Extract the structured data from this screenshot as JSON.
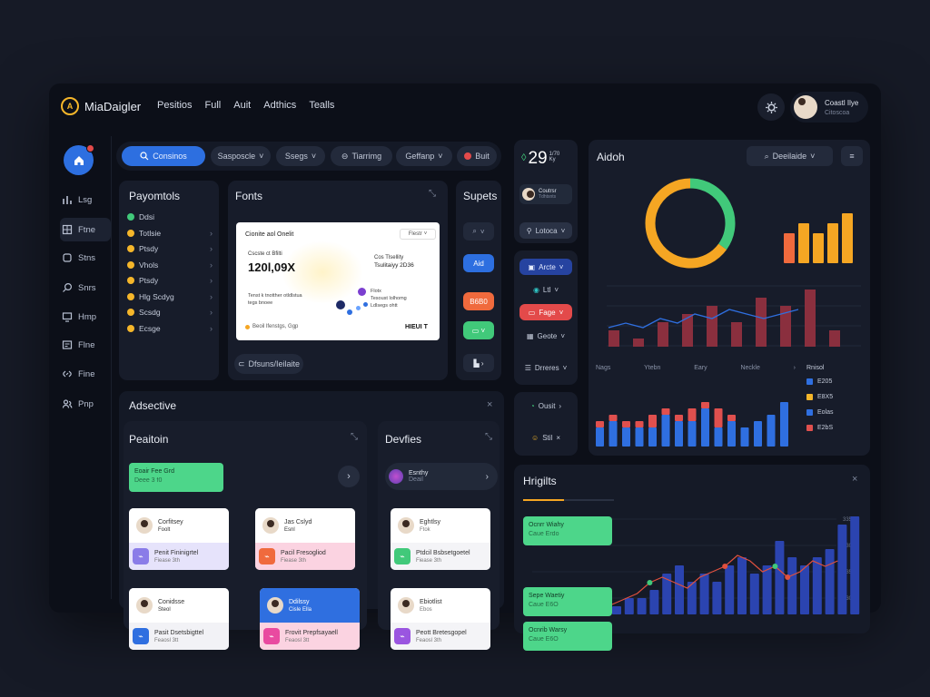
{
  "app": {
    "name": "MiaDaigler",
    "nav": [
      "Pesitios",
      "Full",
      "Auit",
      "Adthics",
      "Tealls"
    ]
  },
  "user": {
    "name": "Coastl Ilye",
    "role": "Citoscoa"
  },
  "sidebar": {
    "items": [
      "Lsg",
      "Ftne",
      "Stns",
      "Snrs",
      "Hmp",
      "Flne",
      "Fine",
      "Pnp"
    ]
  },
  "filters": {
    "search": "Consinos",
    "items": [
      "Sasposcle",
      "Ssegs",
      "Tiarrimg",
      "Geffanp",
      "Buit"
    ]
  },
  "payments": {
    "title": "Payomtols",
    "items": [
      {
        "label": "Ddsi",
        "color": "#41c97a"
      },
      {
        "label": "Totlsie",
        "color": "#f5b62a"
      },
      {
        "label": "Ptsdy",
        "color": "#f5b62a"
      },
      {
        "label": "Vhols",
        "color": "#f5b62a"
      },
      {
        "label": "Ptsdy",
        "color": "#f5b62a"
      },
      {
        "label": "Hlg Scdyg",
        "color": "#f5b62a"
      },
      {
        "label": "Scsdg",
        "color": "#f5b62a"
      },
      {
        "label": "Ecsge",
        "color": "#f5b62a"
      }
    ]
  },
  "fonts_card": {
    "title": "Fonts",
    "paper": {
      "heading": "Cionite aol Onelit",
      "badge": "Flestr",
      "amount_label": "Cscste ct Bfilti",
      "amount": "120l,09X",
      "right_label": "Cos Tlsellity",
      "right_value": "Tsulitaiyy 2D36",
      "note": "Tenst k tnotther otldlstua",
      "note2": "tegs bnoee",
      "legend1": "Flotx",
      "legend2": "Tesoust lolhomg",
      "legend3": "Ldlsegs ohtt",
      "footer": "Beoil lfenstgs, Ggp",
      "footer_right": "HIEUI T"
    },
    "button": "Dfsuns/Ieilaite"
  },
  "supets": {
    "title": "Supets",
    "items": [
      "Aid",
      "B6B0"
    ]
  },
  "stat": {
    "value": "29",
    "sup": "1/70",
    "sub": "Ky"
  },
  "quick": {
    "profile_name": "Coutrsr",
    "profile_sub": "Tdhtsnts",
    "action1": "Lotoca",
    "action2": "Arcte",
    "action3": "Ltl",
    "action4": "Fage",
    "action5": "Geote",
    "action6": "Drreres",
    "action7": "Ousit",
    "action8": "Stil"
  },
  "analytics": {
    "title": "Aidoh",
    "dropdown": "Deeilaide",
    "axis": [
      "Nags",
      "Ytebn",
      "Eary",
      "Neckle"
    ],
    "legend_title": "Rnisol",
    "legend": [
      {
        "label": "E205",
        "color": "#2f6fe0"
      },
      {
        "label": "E8X5",
        "color": "#f5b62a"
      },
      {
        "label": "Eolas",
        "color": "#2f6fe0"
      },
      {
        "label": "E2bS",
        "color": "#e0504e"
      }
    ],
    "donut": [
      {
        "value": 35,
        "color": "#41c97a"
      },
      {
        "value": 65,
        "color": "#f5a623"
      }
    ],
    "bars_top": [
      3,
      4,
      3,
      4,
      5
    ],
    "bars_mid": [
      2,
      1,
      3,
      4,
      5,
      3,
      6,
      5,
      7,
      2
    ],
    "line_mid": [
      3,
      4,
      3,
      5,
      4,
      6,
      5,
      7,
      6,
      5,
      6,
      7
    ],
    "stack": [
      [
        3,
        1
      ],
      [
        4,
        1
      ],
      [
        3,
        1
      ],
      [
        3,
        1
      ],
      [
        3,
        2
      ],
      [
        5,
        1
      ],
      [
        4,
        1
      ],
      [
        4,
        2
      ],
      [
        6,
        1
      ],
      [
        3,
        3
      ],
      [
        4,
        1
      ],
      [
        3,
        0
      ],
      [
        4,
        0
      ],
      [
        5,
        0
      ],
      [
        7,
        0
      ]
    ]
  },
  "activity": {
    "title": "Adsective"
  },
  "position": {
    "title": "Peaitoin",
    "badge_title": "Eoair Fee Grd",
    "badge_sub": "Deee 3 f0",
    "cards": [
      {
        "name": "Corfitsey",
        "sub": "Foolt",
        "line1": "Penit Fininigrtel",
        "line2": "Fiease 3th",
        "color": "#8a7ce8",
        "bg": "#e6e3fb",
        "type": "person"
      },
      {
        "name": "Jas Cslyd",
        "sub": "Esnl",
        "line1": "Pacil Fresogliod",
        "line2": "Fiease 3th",
        "color": "#f06a3d",
        "bg": "#fbd3e1",
        "type": "person"
      },
      {
        "name": "Conidsse",
        "sub": "Steol",
        "line1": "Pasit Dsetsbigttel",
        "line2": "Feaosl 3tt",
        "color": "#2f6fe0",
        "bg": "#f2f2f6",
        "type": "person"
      },
      {
        "name": "Ddilssy",
        "sub": "Cisle Ella",
        "line1": "Frovit Prepfsayaell",
        "line2": "Feaosl 3tt",
        "color": "#e94aa0",
        "bg": "#fbd3e1",
        "type": "blue"
      }
    ]
  },
  "devices": {
    "title": "Devfies",
    "badge_title": "Esnthy",
    "badge_sub": "Deail",
    "cards": [
      {
        "name": "Eghtlsy",
        "sub": "Ftok",
        "line1": "Ptdcil Bsbsetgoetel",
        "line2": "Fiease 3th",
        "color": "#41c97a",
        "bg": "#ffffff"
      },
      {
        "name": "Ebiotlist",
        "sub": "Ebos",
        "line1": "Peott Bretesgopel",
        "line2": "Feaosl 3th",
        "color": "#9a55e0",
        "bg": "#ffffff"
      }
    ]
  },
  "highlights": {
    "title": "Hrigilts",
    "items": [
      {
        "t": "Ocnrr Wiahy",
        "s": "Caue Erdo"
      },
      {
        "t": "Sepe Waetiy",
        "s": "Caue E6O"
      },
      {
        "t": "Ocnrib Warsy",
        "s": "Caue E6O"
      }
    ],
    "bars": [
      1,
      2,
      2,
      3,
      5,
      6,
      4,
      5,
      4,
      6,
      7,
      5,
      6,
      9,
      7,
      6,
      7,
      8,
      11,
      12
    ],
    "line": [
      1,
      2,
      3,
      5,
      6,
      5,
      4,
      6,
      7,
      8,
      10,
      9,
      7,
      8,
      6,
      7,
      9,
      8,
      9
    ],
    "yticks": [
      "3350",
      "3300",
      "2350",
      "3300"
    ]
  }
}
